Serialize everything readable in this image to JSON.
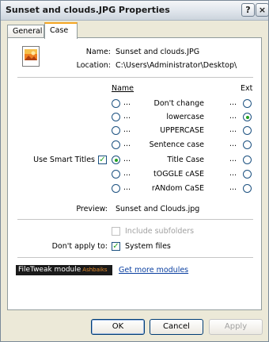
{
  "window": {
    "title": "Sunset and clouds.JPG Properties",
    "help": "?",
    "close": "×"
  },
  "tabs": [
    {
      "label": "General"
    },
    {
      "label": "Case"
    }
  ],
  "file": {
    "name_label": "Name:",
    "name_value": "Sunset and clouds.JPG",
    "location_label": "Location:",
    "location_value": "C:\\Users\\Administrator\\Desktop\\"
  },
  "columns": {
    "name": "Name",
    "ext": "Ext"
  },
  "options": [
    {
      "label": "Don't change",
      "name_checked": false,
      "ext_checked": false
    },
    {
      "label": "lowercase",
      "name_checked": false,
      "ext_checked": true
    },
    {
      "label": "UPPERCASE",
      "name_checked": false,
      "ext_checked": false
    },
    {
      "label": "Sentence case",
      "name_checked": false,
      "ext_checked": false
    },
    {
      "label": "Title Case",
      "name_checked": true,
      "ext_checked": false
    },
    {
      "label": "tOGGLE cASE",
      "name_checked": false,
      "ext_checked": false
    },
    {
      "label": "rANdom CaSE",
      "name_checked": false,
      "ext_checked": false
    }
  ],
  "dots": "...",
  "smart_titles": {
    "label": "Use Smart Titles",
    "checked": true,
    "mark": "✓"
  },
  "preview": {
    "label": "Preview:",
    "value": "Sunset and Clouds.jpg"
  },
  "include_subfolders": {
    "label": "Include subfolders",
    "checked": false
  },
  "dont_apply": {
    "label": "Don't apply to:",
    "option": "System files",
    "checked": true,
    "mark": "✓"
  },
  "module": {
    "name": "FileTweak module",
    "sub": "Ashbaiks",
    "link": "Get more modules"
  },
  "buttons": {
    "ok": "OK",
    "cancel": "Cancel",
    "apply": "Apply"
  },
  "colors": {
    "accent": "#f5a623",
    "check": "#21a121",
    "link": "#0a3fa0"
  }
}
